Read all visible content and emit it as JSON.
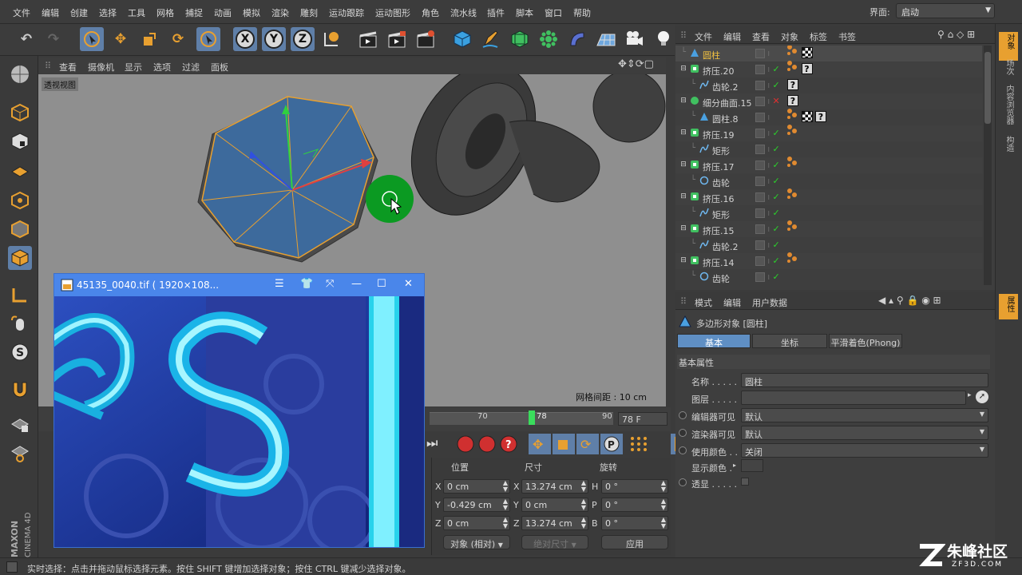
{
  "menu": [
    "文件",
    "编辑",
    "创建",
    "选择",
    "工具",
    "网格",
    "捕捉",
    "动画",
    "模拟",
    "渲染",
    "雕刻",
    "运动跟踪",
    "运动图形",
    "角色",
    "流水线",
    "插件",
    "脚本",
    "窗口",
    "帮助"
  ],
  "layout": {
    "label": "界面:",
    "value": "启动"
  },
  "viewport": {
    "menu": [
      "查看",
      "摄像机",
      "显示",
      "选项",
      "过滤",
      "面板"
    ],
    "label": "透视视图",
    "grid": "网格间距 : 10 cm"
  },
  "timeline": {
    "ticks": [
      "70",
      "90"
    ],
    "marker": "78",
    "frame": "78 F"
  },
  "coords": {
    "headers": {
      "position": "位置",
      "size": "尺寸",
      "rotation": "旋转"
    },
    "rows": [
      {
        "axis": "X",
        "pos": "0 cm",
        "size_axis": "X",
        "size": "13.274 cm",
        "rot_axis": "H",
        "rot": "0 °"
      },
      {
        "axis": "Y",
        "pos": "-0.429 cm",
        "size_axis": "Y",
        "size": "0 cm",
        "rot_axis": "P",
        "rot": "0 °"
      },
      {
        "axis": "Z",
        "pos": "0 cm",
        "size_axis": "Z",
        "size": "13.274 cm",
        "rot_axis": "B",
        "rot": "0 °"
      }
    ],
    "mode": "对象 (相对)",
    "size_mode": "绝对尺寸",
    "apply": "应用"
  },
  "object_manager": {
    "menu": [
      "文件",
      "编辑",
      "查看",
      "对象",
      "标签",
      "书签"
    ],
    "objects": [
      {
        "name": "圆柱",
        "indent": 0,
        "icon": "polygon-icon",
        "color": "#f0c040",
        "check": "none",
        "tags": [
          "dot",
          "chk"
        ]
      },
      {
        "name": "挤压.20",
        "indent": 0,
        "icon": "extrude-icon",
        "color": "#d2d2d2",
        "check": "ok",
        "tags": [
          "dot",
          "q"
        ]
      },
      {
        "name": "齿轮.2",
        "indent": 1,
        "icon": "spline-icon",
        "color": "#d2d2d2",
        "check": "ok",
        "tags": [
          "q"
        ]
      },
      {
        "name": "细分曲面.15",
        "indent": 0,
        "icon": "subdivision-icon",
        "color": "#d2d2d2",
        "check": "x",
        "tags": [
          "q"
        ]
      },
      {
        "name": "圆柱.8",
        "indent": 1,
        "icon": "polygon-icon",
        "color": "#d2d2d2",
        "check": "none",
        "tags": [
          "dot",
          "chk",
          "q"
        ]
      },
      {
        "name": "挤压.19",
        "indent": 0,
        "icon": "extrude-icon",
        "color": "#d2d2d2",
        "check": "ok",
        "tags": [
          "dot"
        ]
      },
      {
        "name": "矩形",
        "indent": 1,
        "icon": "spline-icon",
        "color": "#d2d2d2",
        "check": "ok",
        "tags": []
      },
      {
        "name": "挤压.17",
        "indent": 0,
        "icon": "extrude-icon",
        "color": "#d2d2d2",
        "check": "ok",
        "tags": [
          "dot"
        ]
      },
      {
        "name": "齿轮",
        "indent": 1,
        "icon": "circle-spline-icon",
        "color": "#d2d2d2",
        "check": "ok",
        "tags": []
      },
      {
        "name": "挤压.16",
        "indent": 0,
        "icon": "extrude-icon",
        "color": "#d2d2d2",
        "check": "ok",
        "tags": [
          "dot"
        ]
      },
      {
        "name": "矩形",
        "indent": 1,
        "icon": "spline-icon",
        "color": "#d2d2d2",
        "check": "ok",
        "tags": []
      },
      {
        "name": "挤压.15",
        "indent": 0,
        "icon": "extrude-icon",
        "color": "#d2d2d2",
        "check": "ok",
        "tags": [
          "dot"
        ]
      },
      {
        "name": "齿轮.2",
        "indent": 1,
        "icon": "spline-icon",
        "color": "#d2d2d2",
        "check": "ok",
        "tags": []
      },
      {
        "name": "挤压.14",
        "indent": 0,
        "icon": "extrude-icon",
        "color": "#d2d2d2",
        "check": "ok",
        "tags": [
          "dot"
        ]
      },
      {
        "name": "齿轮",
        "indent": 1,
        "icon": "circle-spline-icon",
        "color": "#d2d2d2",
        "check": "ok",
        "tags": []
      }
    ]
  },
  "side_tabs": [
    "对象",
    "场次",
    "内容浏览器",
    "构造"
  ],
  "attr_side_tab": "属性",
  "attribute_manager": {
    "menu": [
      "模式",
      "编辑",
      "用户数据"
    ],
    "title": "多边形对象 [圆柱]",
    "tabs": [
      "基本",
      "坐标",
      "平滑着色(Phong)"
    ],
    "section": "基本属性",
    "fields": [
      {
        "label": "名称 . . . . .",
        "value": "圆柱",
        "radio": false,
        "dropdown": false
      },
      {
        "label": "图层 . . . . .",
        "value": "",
        "radio": false,
        "dropdown": false
      },
      {
        "label": "编辑器可见",
        "value": "默认",
        "radio": true,
        "dropdown": true
      },
      {
        "label": "渲染器可见",
        "value": "默认",
        "radio": true,
        "dropdown": true
      },
      {
        "label": "使用颜色 . .",
        "value": "关闭",
        "radio": true,
        "dropdown": true
      },
      {
        "label": "显示颜色 .",
        "value": "",
        "radio": false,
        "dropdown": false
      },
      {
        "label": "透显 . . . . .",
        "value": "",
        "radio": true,
        "dropdown": false
      }
    ]
  },
  "status": "实时选择：点击并拖动鼠标选择元素。按住 SHIFT 键增加选择对象；按住 CTRL 键减少选择对象。",
  "image_window": {
    "title": "45135_0040.tif ( 1920×108..."
  },
  "watermark": {
    "brand": "朱峰社区",
    "url": "ZF3D.COM"
  },
  "maxon": {
    "brand": "MAXON",
    "product": "CINEMA 4D"
  },
  "colors": {
    "accent": "#5f8fc4",
    "image_window": "#4a86ea"
  }
}
